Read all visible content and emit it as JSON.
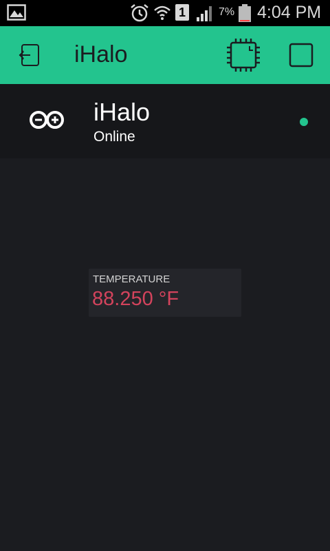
{
  "status_bar": {
    "sim_slot": "1",
    "battery_percent": "7%",
    "time": "4:04 PM"
  },
  "app_bar": {
    "title": "iHalo",
    "accent_color": "#23c48e"
  },
  "device": {
    "name": "iHalo",
    "status": "Online",
    "status_color": "#23c48e"
  },
  "widgets": [
    {
      "label": "TEMPERATURE",
      "value": "88.250 °F",
      "value_color": "#d3435c"
    }
  ]
}
